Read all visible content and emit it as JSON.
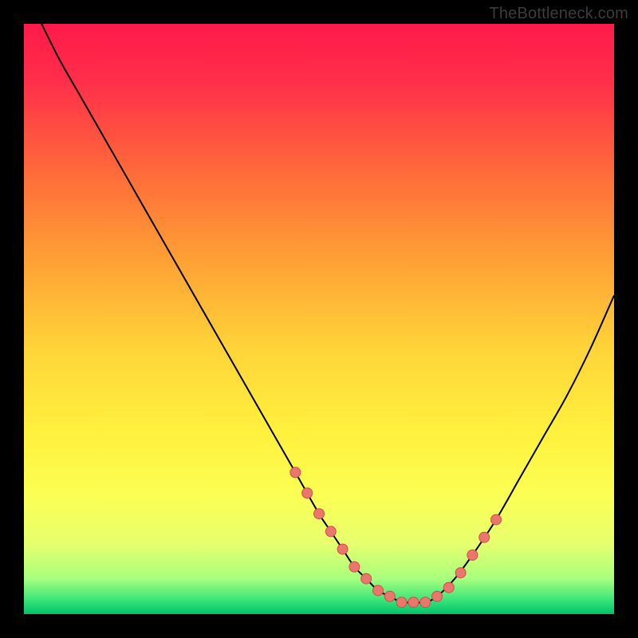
{
  "watermark": "TheBottleneck.com",
  "colors": {
    "background": "#000000",
    "watermark_text": "#3c3c3c",
    "curve": "#000000",
    "marker_fill": "#e9776e",
    "marker_stroke": "#d44d44",
    "gradient_stops": [
      {
        "offset": 0.0,
        "color": "#ff1a4b"
      },
      {
        "offset": 0.1,
        "color": "#ff2f4a"
      },
      {
        "offset": 0.25,
        "color": "#ff6a3a"
      },
      {
        "offset": 0.4,
        "color": "#ffa035"
      },
      {
        "offset": 0.55,
        "color": "#ffd439"
      },
      {
        "offset": 0.7,
        "color": "#fff23e"
      },
      {
        "offset": 0.8,
        "color": "#fbff54"
      },
      {
        "offset": 0.88,
        "color": "#e7ff6e"
      },
      {
        "offset": 0.94,
        "color": "#a8ff7e"
      },
      {
        "offset": 0.975,
        "color": "#3de67a"
      },
      {
        "offset": 1.0,
        "color": "#00c26b"
      }
    ]
  },
  "chart_data": {
    "type": "line",
    "title": "",
    "xlabel": "",
    "ylabel": "",
    "xlim": [
      0,
      100
    ],
    "ylim": [
      0,
      100
    ],
    "grid": false,
    "legend": false,
    "series": [
      {
        "name": "bottleneck-curve",
        "x": [
          3,
          6,
          10,
          14,
          18,
          22,
          26,
          30,
          34,
          38,
          42,
          46,
          50,
          52,
          54,
          56,
          58,
          60,
          62,
          64,
          66,
          68,
          70,
          73,
          76,
          80,
          84,
          88,
          92,
          96,
          100
        ],
        "y": [
          100,
          94,
          87,
          80,
          73,
          66,
          59,
          52,
          45,
          38,
          31,
          24,
          17,
          14,
          11,
          8,
          6,
          4,
          3,
          2,
          2,
          2,
          3,
          6,
          10,
          16,
          23,
          30,
          37,
          45,
          54
        ]
      }
    ],
    "markers": {
      "name": "highlight-points",
      "x": [
        46,
        48,
        50,
        52,
        54,
        56,
        58,
        60,
        62,
        64,
        66,
        68,
        70,
        72,
        74,
        76,
        78,
        80
      ],
      "y": [
        24,
        20.5,
        17,
        14,
        11,
        8,
        6,
        4,
        3,
        2,
        2,
        2,
        3,
        4.5,
        7,
        10,
        13,
        16
      ]
    }
  }
}
